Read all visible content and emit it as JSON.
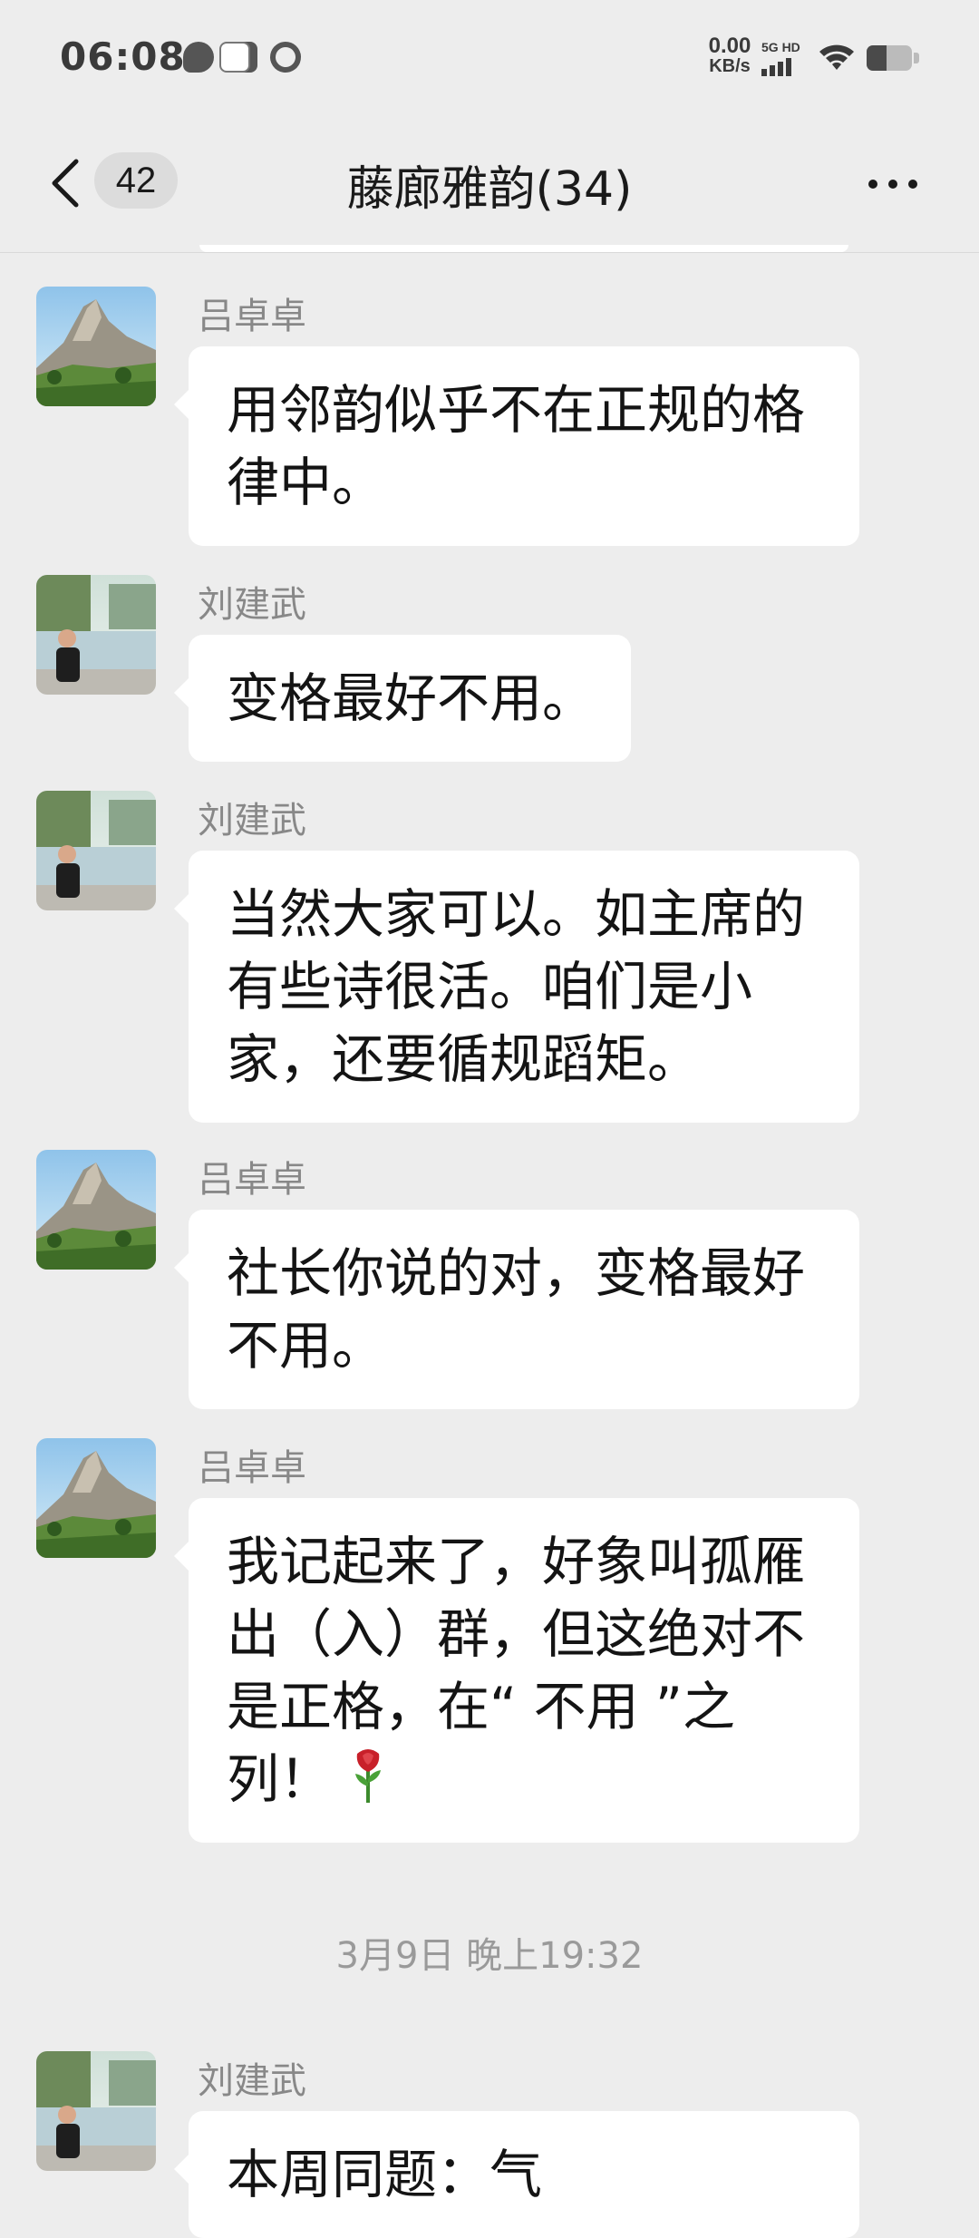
{
  "status_bar": {
    "time": "06:08",
    "net_speed_value": "0.00",
    "net_speed_unit": "KB/s",
    "network_label": "5G HD",
    "icons": [
      "avatar-icon",
      "chat-bubble-icon",
      "mail-icon",
      "link-icon",
      "signal-icon",
      "wifi-icon",
      "battery-icon"
    ]
  },
  "nav": {
    "unread_count": "42",
    "title": "藤廊雅韵(34)",
    "icons": [
      "back-chevron-icon",
      "more-dots-icon"
    ]
  },
  "messages": [
    {
      "sender": "吕卓卓",
      "avatar": "mountain",
      "text": "用邻韵似乎不在正规的格律中。"
    },
    {
      "sender": "刘建武",
      "avatar": "lake-portrait",
      "text": "变格最好不用。"
    },
    {
      "sender": "刘建武",
      "avatar": "lake-portrait",
      "text": "当然大家可以。如主席的有些诗很活。咱们是小家，还要循规蹈矩。"
    },
    {
      "sender": "吕卓卓",
      "avatar": "mountain",
      "text": "社长你说的对，变格最好不用。"
    },
    {
      "sender": "吕卓卓",
      "avatar": "mountain",
      "text": "我记起来了，好象叫孤雁出（入）群，但这绝对不是正格，在“ 不用 ”之列！",
      "emoji": "rose-emoji"
    },
    {
      "sender": "刘建武",
      "avatar": "lake-portrait",
      "text": "本周同题：气"
    }
  ],
  "timestamp": "3月9日 晚上19:32",
  "colors": {
    "background": "#ededed",
    "bubble": "#ffffff",
    "text": "#141414",
    "meta_text": "#888888"
  }
}
